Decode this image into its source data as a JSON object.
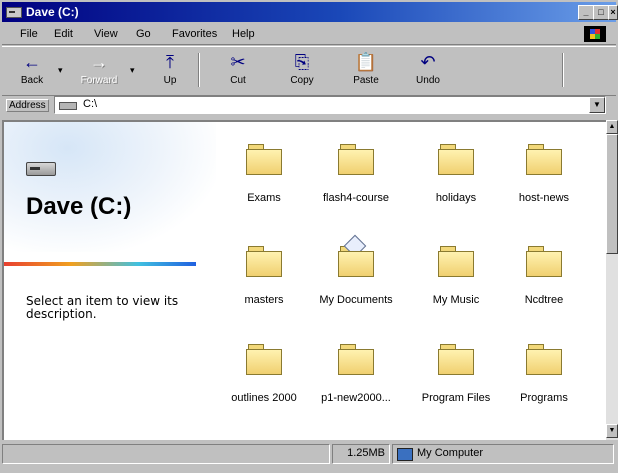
{
  "window": {
    "title": "Dave (C:)",
    "controls": {
      "minimize": "_",
      "maximize": "□",
      "close": "×"
    }
  },
  "menu": [
    "File",
    "Edit",
    "View",
    "Go",
    "Favorites",
    "Help"
  ],
  "toolbar": {
    "back": "Back",
    "forward": "Forward",
    "up": "Up",
    "cut": "Cut",
    "copy": "Copy",
    "paste": "Paste",
    "undo": "Undo",
    "icons": {
      "back": "←",
      "forward": "→",
      "up": "⤒",
      "cut": "✂",
      "copy": "⎘",
      "paste": "📋",
      "undo": "↶"
    }
  },
  "address": {
    "label": "Address",
    "value": "C:\\"
  },
  "left_panel": {
    "title": "Dave (C:)",
    "description": "Select an item to view its description."
  },
  "folders": [
    "Exams",
    "flash4-course",
    "holidays",
    "host-news",
    "masters",
    "My Documents",
    "My Music",
    "Ncdtree",
    "outlines 2000",
    "p1-new2000...",
    "Program Files",
    "Programs"
  ],
  "status": {
    "size": "1.25MB",
    "location": "My Computer"
  }
}
